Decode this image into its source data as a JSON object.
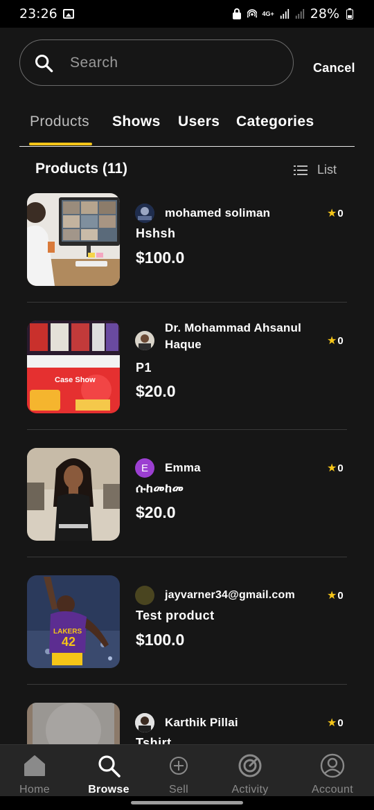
{
  "status_bar": {
    "time": "23:26",
    "network": "4G+",
    "battery": "28%"
  },
  "search": {
    "placeholder": "Search",
    "cancel_label": "Cancel"
  },
  "tabs": [
    {
      "label": "Products",
      "active": true
    },
    {
      "label": "Shows",
      "active": false
    },
    {
      "label": "Users",
      "active": false
    },
    {
      "label": "Categories",
      "active": false
    }
  ],
  "section": {
    "title": "Products (11)",
    "view_toggle_label": "List"
  },
  "products": [
    {
      "seller": "mohamed soliman",
      "name": "Hshsh",
      "price": "$100.0",
      "rating": "0",
      "thumb": "video-call-meeting"
    },
    {
      "seller": "Dr. Mohammad Ahsanul Haque",
      "name": "P1",
      "price": "$20.0",
      "rating": "0",
      "thumb": "case-show-banner",
      "thumb_text": "Case Show"
    },
    {
      "seller": "Emma",
      "avatar_initial": "E",
      "name": "ሱከመከመ",
      "price": "$20.0",
      "rating": "0",
      "thumb": "person-portrait"
    },
    {
      "seller": "jayvarner34@gmail.com",
      "name": "Test product",
      "price": "$100.0",
      "rating": "0",
      "thumb": "basketball-player"
    },
    {
      "seller": "Karthik Pillai",
      "name": "Tshirt",
      "price": "",
      "rating": "0",
      "thumb": "gray-texture"
    }
  ],
  "bottom_nav": [
    {
      "label": "Home",
      "icon": "home-icon",
      "active": false
    },
    {
      "label": "Browse",
      "icon": "search-icon",
      "active": true
    },
    {
      "label": "Sell",
      "icon": "plus-circle-icon",
      "active": false
    },
    {
      "label": "Activity",
      "icon": "activity-gauge-icon",
      "active": false
    },
    {
      "label": "Account",
      "icon": "user-circle-icon",
      "active": false
    }
  ],
  "colors": {
    "background": "#161616",
    "accent": "#f5c518",
    "nav_background": "#262626",
    "avatar_emma": "#9b3fd1"
  }
}
